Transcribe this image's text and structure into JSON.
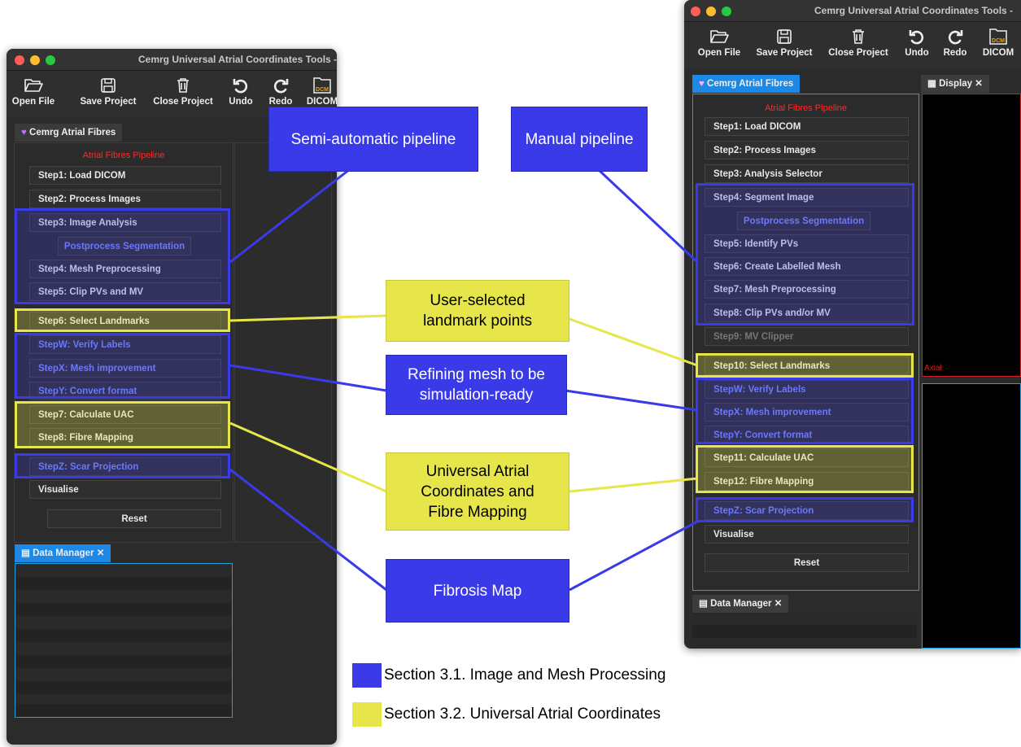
{
  "app_title": "Cemrg Universal Atrial Coordinates Tools -",
  "toolbar": {
    "open_file": "Open File",
    "save_project": "Save Project",
    "close_project": "Close Project",
    "undo": "Undo",
    "redo": "Redo",
    "dicom": "DICOM",
    "dicom_badge": "DCM"
  },
  "plugin_tab": "Cemrg Atrial Fibres",
  "display_tab": "Display",
  "data_manager_tab": "Data Manager",
  "pipeline_title": "Atrial Fibres Pipeline",
  "left_steps": {
    "s1": "Step1: Load DICOM",
    "s2": "Step2: Process Images",
    "s3": "Step3: Image Analysis",
    "post": "Postprocess Segmentation",
    "s4": "Step4: Mesh Preprocessing",
    "s5": "Step5: Clip PVs and MV",
    "s6": "Step6: Select Landmarks",
    "sw": "StepW: Verify Labels",
    "sx": "StepX: Mesh improvement",
    "sy": "StepY: Convert format",
    "s7": "Step7: Calculate UAC",
    "s8": "Step8: Fibre Mapping",
    "sz": "StepZ: Scar Projection",
    "vis": "Visualise",
    "reset": "Reset"
  },
  "right_steps": {
    "s1": "Step1: Load DICOM",
    "s2": "Step2: Process Images",
    "s3": "Step3: Analysis Selector",
    "s4": "Step4: Segment Image",
    "post": "Postprocess Segmentation",
    "s5": "Step5: Identify PVs",
    "s6": "Step6: Create Labelled Mesh",
    "s7": "Step7: Mesh Preprocessing",
    "s8": "Step8: Clip PVs and/or MV",
    "s9": "Step9: MV Clipper",
    "s10": "Step10: Select Landmarks",
    "sw": "StepW: Verify Labels",
    "sx": "StepX: Mesh improvement",
    "sy": "StepY: Convert format",
    "s11": "Step11: Calculate UAC",
    "s12": "Step12: Fibre Mapping",
    "sz": "StepZ: Scar Projection",
    "vis": "Visualise",
    "reset": "Reset"
  },
  "viewer_label": "Axial",
  "callouts": {
    "semi": "Semi-automatic pipeline",
    "manual": "Manual pipeline",
    "landmarks_1": "User-selected",
    "landmarks_2": "landmark points",
    "refine_1": "Refining mesh to be",
    "refine_2": "simulation-ready",
    "uac_1": "Universal Atrial",
    "uac_2": "Coordinates and",
    "uac_3": "Fibre Mapping",
    "fibrosis": "Fibrosis Map"
  },
  "legend": {
    "blue_label": "Section 3.1. Image and Mesh Processing",
    "yellow_label": "Section 3.2. Universal Atrial Coordinates",
    "blue_color": "#3a3ae8",
    "yellow_color": "#e6e64a"
  }
}
